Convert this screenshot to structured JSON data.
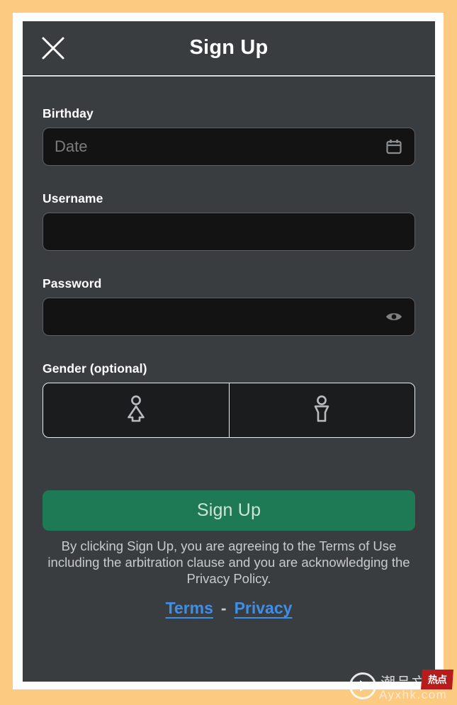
{
  "window": {
    "background_color": "#fcca81",
    "frame_color": "#ffffff",
    "panel_color": "#3a3d40"
  },
  "header": {
    "title": "Sign Up",
    "close_icon": "close-icon"
  },
  "form": {
    "birthday": {
      "label": "Birthday",
      "placeholder": "Date",
      "value": "",
      "icon": "calendar-icon"
    },
    "username": {
      "label": "Username",
      "placeholder": "",
      "value": ""
    },
    "password": {
      "label": "Password",
      "placeholder": "",
      "value": "",
      "icon": "eye-icon"
    },
    "gender": {
      "label": "Gender (optional)",
      "options": [
        {
          "name": "female",
          "icon": "female-person-icon"
        },
        {
          "name": "male",
          "icon": "male-person-icon"
        }
      ]
    }
  },
  "actions": {
    "signup_label": "Sign Up",
    "signup_color": "#1e7a54",
    "legal_text": "By clicking Sign Up, you are agreeing to the Terms of Use including the arbitration clause and you are acknowledging the Privacy Policy.",
    "terms_label": "Terms",
    "separator": "-",
    "privacy_label": "Privacy",
    "link_color": "#3f8ee8"
  },
  "watermark": {
    "brand_cn": "潮品文",
    "badge_text": "热点",
    "url": "Ayxhk.com",
    "play_icon": "play-circle-icon"
  }
}
